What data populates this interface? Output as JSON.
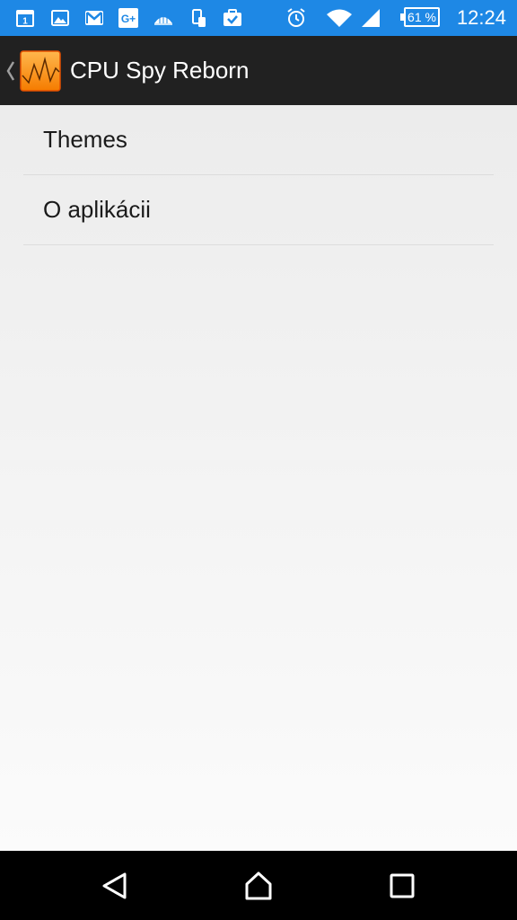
{
  "status_bar": {
    "calendar_day": "1",
    "gplus_label": "G+",
    "battery_percent": "61 %",
    "time": "12:24",
    "icons": [
      "calendar-icon",
      "gallery-icon",
      "gmail-icon",
      "google-plus-icon",
      "dome-icon",
      "phone-transfer-icon",
      "briefcase-check-icon",
      "alarm-icon",
      "wifi-icon",
      "cell-signal-icon",
      "battery-icon"
    ]
  },
  "action_bar": {
    "title": "CPU Spy Reborn",
    "icons": [
      "up-chevron-icon",
      "app-logo-icon"
    ]
  },
  "menu": {
    "items": [
      {
        "label": "Themes"
      },
      {
        "label": "O aplikácii"
      }
    ]
  },
  "nav_bar": {
    "icons": [
      "back-icon",
      "home-icon",
      "recents-icon"
    ]
  },
  "colors": {
    "status_bar": "#1e88e5",
    "action_bar": "#212121",
    "app_icon_orange": "#f7941d",
    "background": "#f2f2f2",
    "nav_bar": "#000000"
  }
}
